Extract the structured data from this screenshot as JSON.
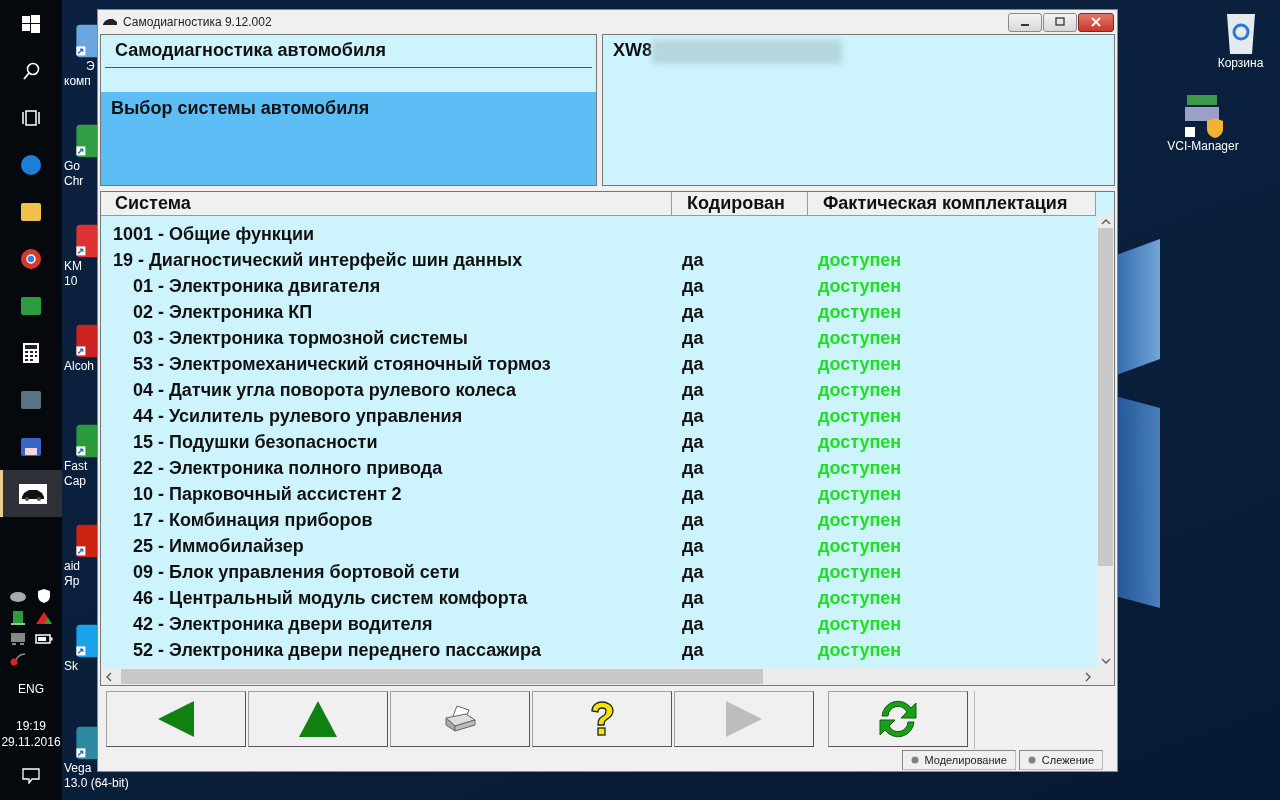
{
  "taskbar": {
    "apps": [
      {
        "kind": "windows",
        "selected": false
      },
      {
        "kind": "search",
        "selected": false
      },
      {
        "kind": "taskview",
        "selected": false
      },
      {
        "kind": "edge",
        "selected": false
      },
      {
        "kind": "folder",
        "selected": false
      },
      {
        "kind": "chrome",
        "selected": false
      },
      {
        "kind": "app",
        "selected": false
      },
      {
        "kind": "calculator",
        "selected": false
      },
      {
        "kind": "film",
        "selected": false
      },
      {
        "kind": "floppy",
        "selected": false
      },
      {
        "kind": "car",
        "selected": true
      }
    ],
    "tray": {
      "language": "ENG",
      "time": "19:19",
      "date": "29.11.2016"
    }
  },
  "desktop_icons": [
    {
      "kind": "computer",
      "lines": [
        "Э",
        "комп"
      ]
    },
    {
      "kind": "chrome",
      "lines": [
        "Go",
        "Chr"
      ]
    },
    {
      "kind": "button",
      "lines": [
        "KM",
        "10"
      ]
    },
    {
      "kind": "alcohol",
      "lines": [
        "Alcoh"
      ]
    },
    {
      "kind": "fastcap",
      "lines": [
        "Fast",
        "Cap"
      ]
    },
    {
      "kind": "aida",
      "lines": [
        "aid",
        "Яр"
      ]
    },
    {
      "kind": "skype",
      "lines": [
        "Sk"
      ]
    },
    {
      "kind": "vegas",
      "lines": [
        "Vega",
        "13.0 (64-bit)"
      ]
    },
    {
      "kind": "bin",
      "lines": [
        "Корзина"
      ]
    },
    {
      "kind": "vci",
      "lines": [
        "VCI-Manager"
      ]
    }
  ],
  "window": {
    "title": "Самодиагностика 9.12.002",
    "header": {
      "title": "Самодиагностика автомобиля",
      "step": "Выбор системы автомобиля",
      "vin": "XW8"
    },
    "table": {
      "columns": [
        "Система",
        "Кодирован",
        "Фактическая комплектация"
      ],
      "rows": [
        {
          "system": "1001 - Общие функции"
        },
        {
          "system": "19 - Диагностический интерфейс шин данных",
          "coded": "да",
          "status": "доступен",
          "children": [
            {
              "system": "01 - Электроника двигателя",
              "coded": "да",
              "status": "доступен"
            },
            {
              "system": "02 - Электроника КП",
              "coded": "да",
              "status": "доступен"
            },
            {
              "system": "03 - Электроника тормозной системы",
              "coded": "да",
              "status": "доступен"
            },
            {
              "system": "53 - Электромеханический стояночный тормоз",
              "coded": "да",
              "status": "доступен"
            },
            {
              "system": "04 - Датчик угла поворота рулевого колеса",
              "coded": "да",
              "status": "доступен"
            },
            {
              "system": "44 - Усилитель рулевого управления",
              "coded": "да",
              "status": "доступен"
            },
            {
              "system": "15 - Подушки безопасности",
              "coded": "да",
              "status": "доступен"
            },
            {
              "system": "22 - Электроника полного привода",
              "coded": "да",
              "status": "доступен"
            },
            {
              "system": "10 - Парковочный ассистент 2",
              "coded": "да",
              "status": "доступен"
            },
            {
              "system": "17 - Комбинация приборов",
              "coded": "да",
              "status": "доступен"
            },
            {
              "system": "25 - Иммобилайзер",
              "coded": "да",
              "status": "доступен"
            },
            {
              "system": "09 - Блок управления бортовой сети",
              "coded": "да",
              "status": "доступен"
            },
            {
              "system": "46 - Центральный модуль систем комфорта",
              "coded": "да",
              "status": "доступен"
            },
            {
              "system": "42 - Электроника двери водителя",
              "coded": "да",
              "status": "доступен"
            },
            {
              "system": "52 - Электроника двери переднего пассажира",
              "coded": "да",
              "status": "доступен"
            }
          ]
        }
      ]
    },
    "toolbar": [
      {
        "kind": "back",
        "disabled": false
      },
      {
        "kind": "up",
        "disabled": false
      },
      {
        "kind": "print",
        "disabled": false
      },
      {
        "kind": "help",
        "disabled": false
      },
      {
        "kind": "forward",
        "disabled": true
      },
      {
        "kind": "refresh",
        "disabled": false
      }
    ],
    "status_bar": [
      "Моделирование",
      "Слежение"
    ]
  }
}
